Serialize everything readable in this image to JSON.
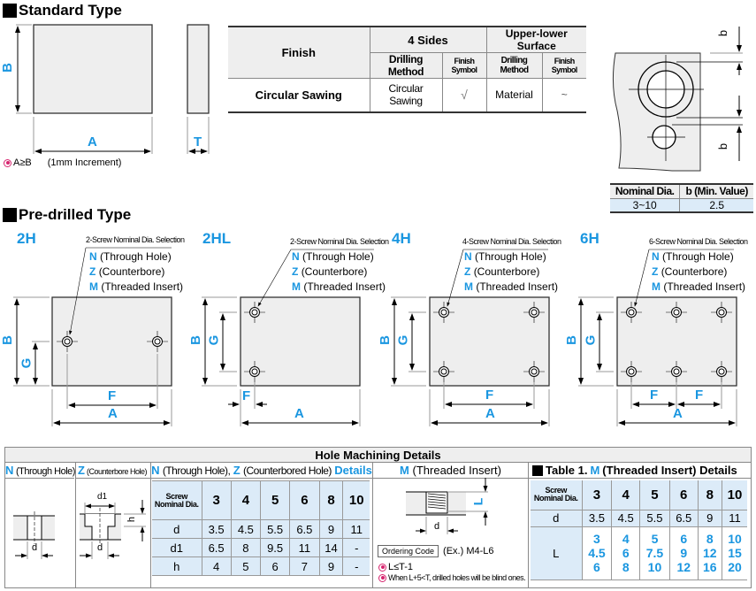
{
  "standard": {
    "title": "Standard Type",
    "dims": {
      "a": "A",
      "b": "B",
      "t": "T"
    },
    "note_condition": "A≥B",
    "note_increment": "(1mm Increment)"
  },
  "finish_table": {
    "col_finish": "Finish",
    "group_4sides": "4 Sides",
    "group_upper_lower": "Upper-lower Surface",
    "sub_drilling": "Drilling Method",
    "sub_symbol": "Finish Symbol",
    "row": {
      "finish": "Circular Sawing",
      "four_sides_method": "Circular Sawing",
      "four_sides_symbol": "√",
      "upper_lower_method": "Material",
      "upper_lower_symbol": "~"
    }
  },
  "b_min": {
    "dim_label": "b",
    "headers": [
      "Nominal Dia.",
      "b (Min. Value)"
    ],
    "row": [
      "3~10",
      "2.5"
    ]
  },
  "predrilled": {
    "title": "Pre-drilled Type",
    "options_n": "N",
    "options_n_text": "(Through Hole)",
    "options_z": "Z",
    "options_z_text": "(Counterbore)",
    "options_m": "M",
    "options_m_text": "(Threaded Insert)",
    "variants": [
      {
        "code": "2H",
        "selection": "2-Screw Nominal Dia. Selection"
      },
      {
        "code": "2HL",
        "selection": "2-Screw Nominal Dia. Selection"
      },
      {
        "code": "4H",
        "selection": "4-Screw Nominal Dia. Selection"
      },
      {
        "code": "6H",
        "selection": "6-Screw Nominal Dia. Selection"
      }
    ],
    "dims": {
      "a": "A",
      "b": "B",
      "f": "F",
      "g": "G"
    }
  },
  "hole_details": {
    "title": "Hole Machining Details",
    "n_label": "N",
    "n_text": "(Through Hole)",
    "z_label": "Z",
    "z_text": "(Counterbore Hole)",
    "nz_header": {
      "n": "N",
      "n_text": "(Through Hole),",
      "z": "Z",
      "z_text": "(Counterbored Hole)",
      "details": "Details"
    },
    "m_header": {
      "m": "M",
      "m_text": "(Threaded Insert)"
    },
    "diagram_labels": {
      "d": "d",
      "d1": "d1",
      "h": "h",
      "L": "L"
    },
    "nz_table": {
      "header_label": "Screw Nominal Dia.",
      "dias": [
        "3",
        "4",
        "5",
        "6",
        "8",
        "10"
      ],
      "rows": [
        {
          "label": "d",
          "values": [
            "3.5",
            "4.5",
            "5.5",
            "6.5",
            "9",
            "11"
          ]
        },
        {
          "label": "d1",
          "values": [
            "6.5",
            "8",
            "9.5",
            "11",
            "14",
            "-"
          ]
        },
        {
          "label": "h",
          "values": [
            "4",
            "5",
            "6",
            "7",
            "9",
            "-"
          ]
        }
      ]
    },
    "ordering": {
      "code_label": "Ordering Code",
      "example": "(Ex.) M4-L6",
      "note1": "L≤T-1",
      "note2": "When L+5<T, drilled holes will be blind ones."
    },
    "table1": {
      "title_prefix": "Table 1.",
      "title_m": "M",
      "title_suffix": "(Threaded Insert) Details",
      "header_label": "Screw Nominal Dia.",
      "dias": [
        "3",
        "4",
        "5",
        "6",
        "8",
        "10"
      ],
      "d_label": "d",
      "d_values": [
        "3.5",
        "4.5",
        "5.5",
        "6.5",
        "9",
        "11"
      ],
      "L_label": "L",
      "L_values": [
        [
          "3",
          "4.5",
          "6"
        ],
        [
          "4",
          "6",
          "8"
        ],
        [
          "5",
          "7.5",
          "10"
        ],
        [
          "6",
          "9",
          "12"
        ],
        [
          "8",
          "12",
          "16"
        ],
        [
          "10",
          "15",
          "20"
        ]
      ]
    }
  }
}
